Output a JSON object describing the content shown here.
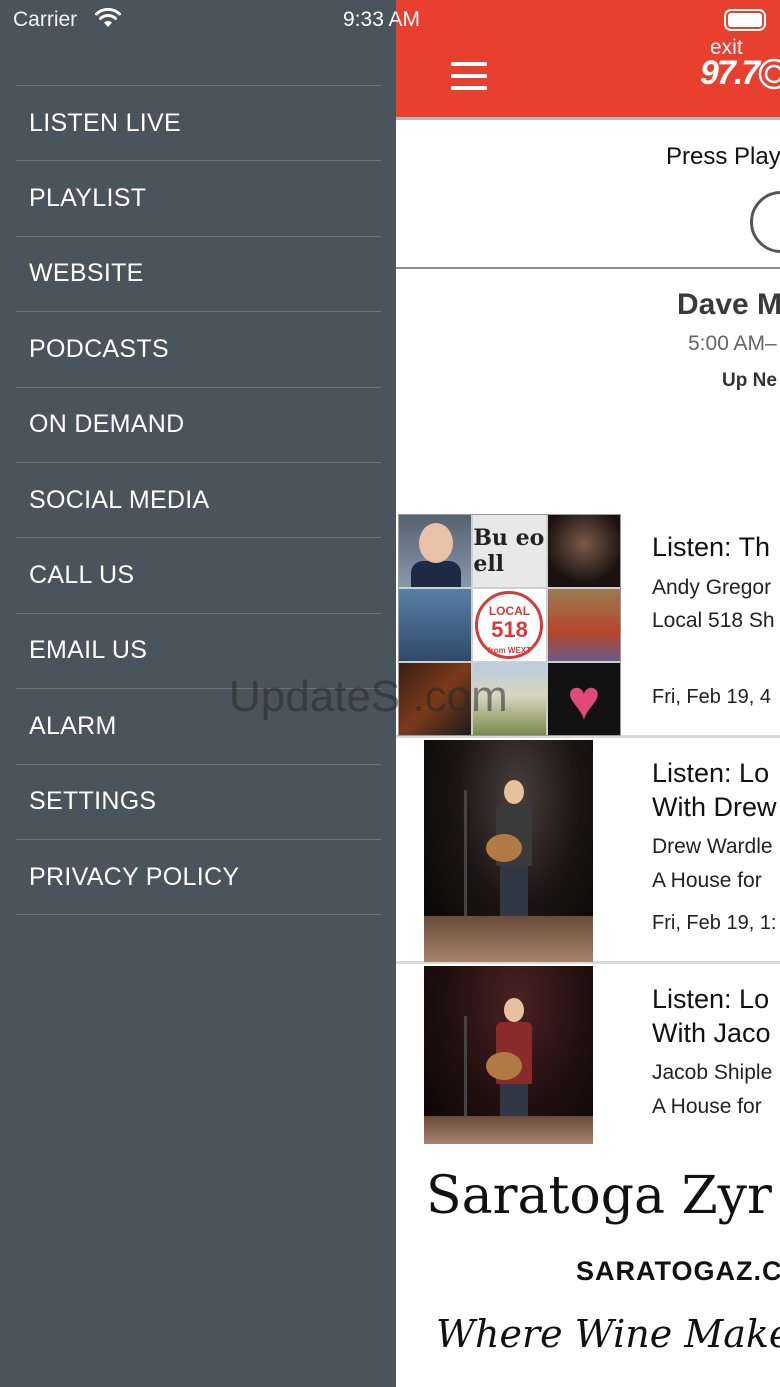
{
  "status_bar": {
    "carrier": "Carrier",
    "time": "9:33 AM"
  },
  "drawer": {
    "items": [
      {
        "label": "LISTEN LIVE"
      },
      {
        "label": "PLAYLIST"
      },
      {
        "label": "WEBSITE"
      },
      {
        "label": "PODCASTS"
      },
      {
        "label": "ON DEMAND"
      },
      {
        "label": "SOCIAL MEDIA"
      },
      {
        "label": "CALL US"
      },
      {
        "label": "EMAIL US"
      },
      {
        "label": "ALARM"
      },
      {
        "label": "SETTINGS"
      },
      {
        "label": "PRIVACY POLICY"
      }
    ]
  },
  "header": {
    "logo_top": "exit",
    "logo_freq": "97.7",
    "brand_color": "#e8402f"
  },
  "player": {
    "prompt": "Press Play"
  },
  "current_show": {
    "title": "Dave M",
    "time": "5:00 AM–",
    "up_next": "Up Ne"
  },
  "stories": [
    {
      "title_line1": "Listen: Th",
      "title_line2": "",
      "author": "Andy Gregor",
      "series": "Local 518 Sh",
      "date": "Fri, Feb 19, 4"
    },
    {
      "title_line1": "Listen: Lo",
      "title_line2": "With Drew",
      "author": "Drew Wardle",
      "series": "A House for",
      "date": "Fri, Feb 19, 1:"
    },
    {
      "title_line1": "Listen: Lo",
      "title_line2": "With Jaco",
      "author": "Jacob Shiple",
      "series": "A House for",
      "date": ""
    }
  ],
  "collage": {
    "tile2_text": "Bu eo ell",
    "badge_top": "LOCAL",
    "badge_num": "518",
    "badge_bottom": "from WEXT Radio"
  },
  "ad": {
    "title": "Saratoga Zyr",
    "url": "SARATOGAZ.C",
    "tagline": "Where Wine Maker"
  },
  "watermark": "UpdateS          .com"
}
